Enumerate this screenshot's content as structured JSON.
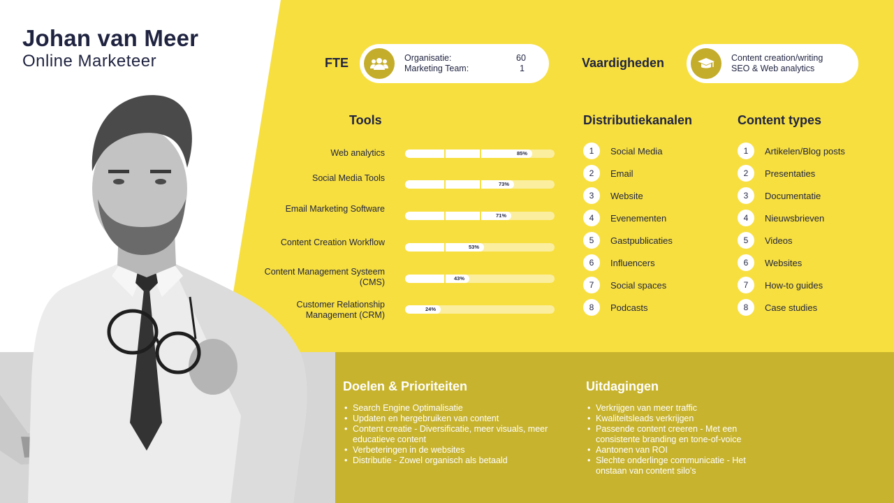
{
  "profile": {
    "name": "Johan van Meer",
    "role": "Online Marketeer"
  },
  "colors": {
    "yellow": "#f7df40",
    "olive": "#c7b32d",
    "navy": "#1f2340",
    "icon_circle": "#c4ad2a"
  },
  "fte": {
    "label": "FTE",
    "icon": "users-icon",
    "rows": [
      {
        "label": "Organisatie:",
        "value": "60"
      },
      {
        "label": "Marketing Team:",
        "value": "1"
      }
    ]
  },
  "skills": {
    "label": "Vaardigheden",
    "icon": "graduation-cap-icon",
    "lines": [
      "Content creation/writing",
      "SEO & Web analytics"
    ]
  },
  "tools": {
    "title": "Tools",
    "items": [
      {
        "label": "Web analytics",
        "percent": 85,
        "percent_label": "85%"
      },
      {
        "label": "Social Media Tools",
        "percent": 73,
        "percent_label": "73%"
      },
      {
        "label": "Email Marketing Software",
        "percent": 71,
        "percent_label": "71%"
      },
      {
        "label": "Content Creation Workflow",
        "percent": 53,
        "percent_label": "53%"
      },
      {
        "label": "Content Management Systeem (CMS)",
        "percent": 43,
        "percent_label": "43%"
      },
      {
        "label": "Customer Relationship Management (CRM)",
        "percent": 24,
        "percent_label": "24%"
      }
    ]
  },
  "channels": {
    "title": "Distributiekanalen",
    "items": [
      {
        "num": "1",
        "label": "Social Media"
      },
      {
        "num": "2",
        "label": "Email"
      },
      {
        "num": "3",
        "label": "Website"
      },
      {
        "num": "4",
        "label": "Evenementen"
      },
      {
        "num": "5",
        "label": "Gastpublicaties"
      },
      {
        "num": "6",
        "label": "Influencers"
      },
      {
        "num": "7",
        "label": "Social spaces"
      },
      {
        "num": "8",
        "label": "Podcasts"
      }
    ]
  },
  "content_types": {
    "title": "Content types",
    "items": [
      {
        "num": "1",
        "label": "Artikelen/Blog posts"
      },
      {
        "num": "2",
        "label": "Presentaties"
      },
      {
        "num": "3",
        "label": "Documentatie"
      },
      {
        "num": "4",
        "label": "Nieuwsbrieven"
      },
      {
        "num": "5",
        "label": "Videos"
      },
      {
        "num": "6",
        "label": "Websites"
      },
      {
        "num": "7",
        "label": "How-to guides"
      },
      {
        "num": "8",
        "label": "Case studies"
      }
    ]
  },
  "goals": {
    "title": "Doelen & Prioriteiten",
    "items": [
      "Search Engine Optimalisatie",
      "Updaten en hergebruiken van content",
      "Content creatie - Diversificatie, meer visuals, meer educatieve content",
      "Verbeteringen in de websites",
      "Distributie - Zowel organisch als betaald"
    ]
  },
  "challenges": {
    "title": "Uitdagingen",
    "items": [
      "Verkrijgen van meer traffic",
      "Kwaliteitsleads verkrijgen",
      "Passende content creeren - Met een consistente branding en tone-of-voice",
      "Aantonen van ROI",
      "Slechte onderlinge communicatie - Het onstaan van content silo's"
    ]
  }
}
